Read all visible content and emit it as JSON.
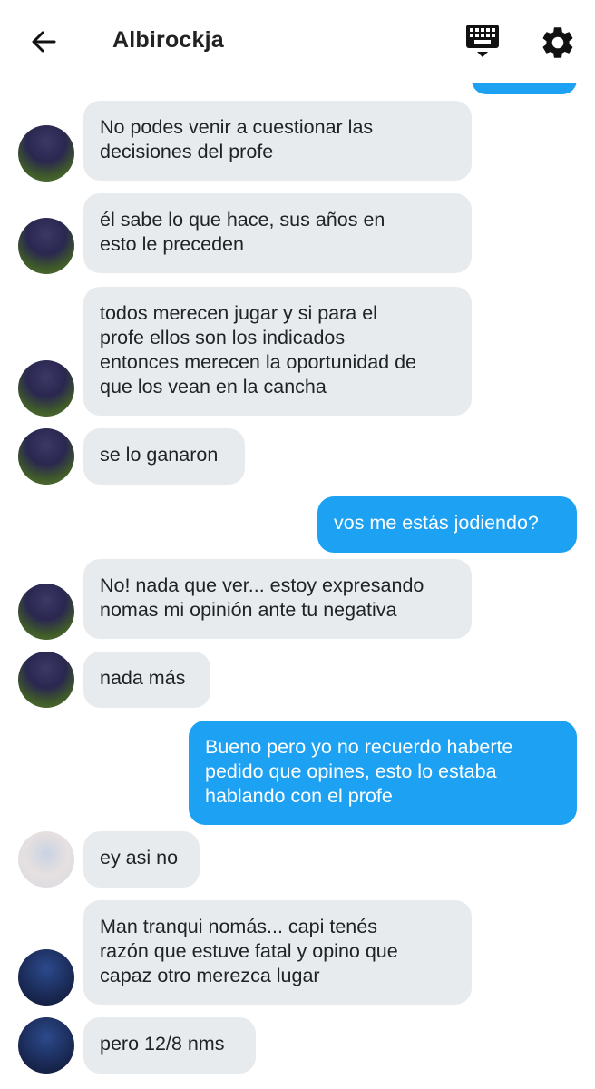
{
  "header": {
    "title": "Albirockja",
    "back_icon": "arrow-left-icon",
    "keyboard_icon": "keyboard-icon",
    "settings_icon": "gear-icon"
  },
  "colors": {
    "outgoing_bubble": "#1da1f2",
    "incoming_bubble": "#e8ebee",
    "outgoing_text": "#ffffff",
    "incoming_text": "#202326"
  },
  "messages": [
    {
      "direction": "in",
      "avatar": "player-dark-kit",
      "text": "No podes venir a cuestionar las\ndecisiones del profe"
    },
    {
      "direction": "in",
      "avatar": "player-dark-kit",
      "text": "él sabe lo que hace, sus años en\nesto le preceden"
    },
    {
      "direction": "in",
      "avatar": "player-dark-kit",
      "text": "todos merecen jugar y si para el\nprofe ellos son los indicados\nentonces merecen la oportunidad de\nque los vean en la cancha"
    },
    {
      "direction": "in",
      "avatar": "player-dark-kit",
      "text": "se lo ganaron"
    },
    {
      "direction": "out",
      "text": "vos me estás jodiendo?"
    },
    {
      "direction": "in",
      "avatar": "player-dark-kit",
      "text": "No! nada que ver... estoy expresando\nnomas mi opinión ante tu negativa"
    },
    {
      "direction": "in",
      "avatar": "player-dark-kit",
      "text": "nada más"
    },
    {
      "direction": "out",
      "text": "Bueno pero yo no recuerdo haberte\npedido que opines, esto lo estaba\nhablando con el profe"
    },
    {
      "direction": "in",
      "avatar": "player-red-white-kit",
      "text": "ey asi no"
    },
    {
      "direction": "in",
      "avatar": "player-blue-kit",
      "text": "Man tranqui nomás... capi tenés\nrazón que estuve fatal y opino que\ncapaz otro merezca lugar"
    },
    {
      "direction": "in",
      "avatar": "player-blue-kit",
      "text": "pero 12/8 nms"
    }
  ]
}
